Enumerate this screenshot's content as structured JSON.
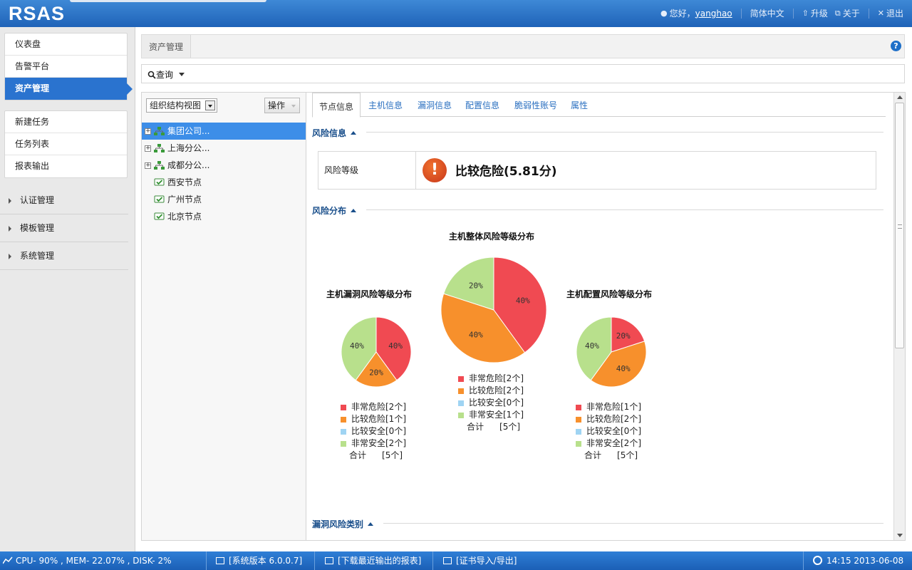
{
  "app": {
    "logo": "RSAS"
  },
  "topnav": {
    "greeting": "您好，",
    "username": "yanghao",
    "language": "简体中文",
    "upgrade": "升级",
    "about": "关于",
    "logout": "退出"
  },
  "sidebar": {
    "primary": [
      "仪表盘",
      "告警平台",
      "资产管理"
    ],
    "tasks": [
      "新建任务",
      "任务列表",
      "报表输出"
    ],
    "groups": [
      "认证管理",
      "模板管理",
      "系统管理"
    ]
  },
  "breadcrumb": {
    "tab": "资产管理"
  },
  "query": {
    "label": "查询"
  },
  "tree": {
    "view_select": "组织结构视图",
    "ops_button": "操作",
    "nodes": [
      "集团公司...",
      "上海分公...",
      "成都分公...",
      "西安节点",
      "广州节点",
      "北京节点"
    ]
  },
  "tabs": [
    "节点信息",
    "主机信息",
    "漏洞信息",
    "配置信息",
    "脆弱性账号",
    "属性"
  ],
  "sections": {
    "risk_info": "风险信息",
    "risk_dist": "风险分布",
    "vuln_types": "漏洞风险类别"
  },
  "risk": {
    "label": "风险等级",
    "value": "比较危险(5.81分)"
  },
  "colors": {
    "very_danger": "#f04a52",
    "danger": "#f7902c",
    "safe": "#9fd4f3",
    "very_safe": "#b8e08c"
  },
  "chart_data": [
    {
      "type": "pie",
      "title": "主机漏洞风险等级分布",
      "slices": [
        {
          "label": "非常危险",
          "count": 2,
          "pct_label": "40%"
        },
        {
          "label": "比较危险",
          "count": 1,
          "pct_label": "20%"
        },
        {
          "label": "比较安全",
          "count": 0,
          "pct_label": ""
        },
        {
          "label": "非常安全",
          "count": 2,
          "pct_label": "40%"
        }
      ],
      "legend": [
        "非常危险[2个]",
        "比较危险[1个]",
        "比较安全[0个]",
        "非常安全[2个]"
      ],
      "total_label": "合计",
      "total_value": "[5个]"
    },
    {
      "type": "pie",
      "title": "主机整体风险等级分布",
      "slices": [
        {
          "label": "非常危险",
          "count": 2,
          "pct_label": "40%"
        },
        {
          "label": "比较危险",
          "count": 2,
          "pct_label": "40%"
        },
        {
          "label": "比较安全",
          "count": 0,
          "pct_label": ""
        },
        {
          "label": "非常安全",
          "count": 1,
          "pct_label": "20%"
        }
      ],
      "legend": [
        "非常危险[2个]",
        "比较危险[2个]",
        "比较安全[0个]",
        "非常安全[1个]"
      ],
      "total_label": "合计",
      "total_value": "[5个]"
    },
    {
      "type": "pie",
      "title": "主机配置风险等级分布",
      "slices": [
        {
          "label": "非常危险",
          "count": 1,
          "pct_label": "20%"
        },
        {
          "label": "比较危险",
          "count": 2,
          "pct_label": "40%"
        },
        {
          "label": "比较安全",
          "count": 0,
          "pct_label": ""
        },
        {
          "label": "非常安全",
          "count": 2,
          "pct_label": "40%"
        }
      ],
      "legend": [
        "非常危险[1个]",
        "比较危险[2个]",
        "比较安全[0个]",
        "非常安全[2个]"
      ],
      "total_label": "合计",
      "total_value": "[5个]"
    }
  ],
  "status": {
    "resources": "CPU- 90% , MEM- 22.07% , DISK- 2%",
    "version": "[系统版本 6.0.0.7]",
    "download": "[下载最近输出的报表]",
    "cert": "[证书导入/导出]",
    "time": "14:15 2013-06-08"
  }
}
